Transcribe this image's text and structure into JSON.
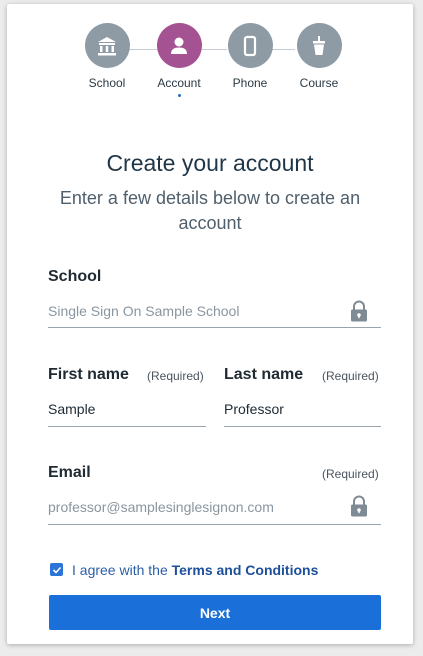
{
  "stepper": {
    "steps": [
      {
        "label": "School",
        "icon": "bank-icon",
        "color": "#8e9ba5"
      },
      {
        "label": "Account",
        "icon": "user-icon",
        "color": "#a45292"
      },
      {
        "label": "Phone",
        "icon": "phone-icon",
        "color": "#8e9ba5"
      },
      {
        "label": "Course",
        "icon": "cup-icon",
        "color": "#8e9ba5"
      }
    ],
    "active_index": 1
  },
  "heading": {
    "title": "Create your account",
    "subtitle": "Enter a few details below to create an account"
  },
  "form": {
    "school": {
      "label": "School",
      "value": "Single Sign On Sample School",
      "locked": true
    },
    "first_name": {
      "label": "First name",
      "required": "(Required)",
      "value": "Sample"
    },
    "last_name": {
      "label": "Last name",
      "required": "(Required)",
      "value": "Professor"
    },
    "email": {
      "label": "Email",
      "required": "(Required)",
      "value": "professor@samplesinglesignon.com",
      "locked": true
    }
  },
  "terms": {
    "checked": true,
    "prefix": "I agree with the ",
    "link": "Terms and Conditions"
  },
  "next_button": {
    "label": "Next",
    "color": "#1a6fd9"
  }
}
